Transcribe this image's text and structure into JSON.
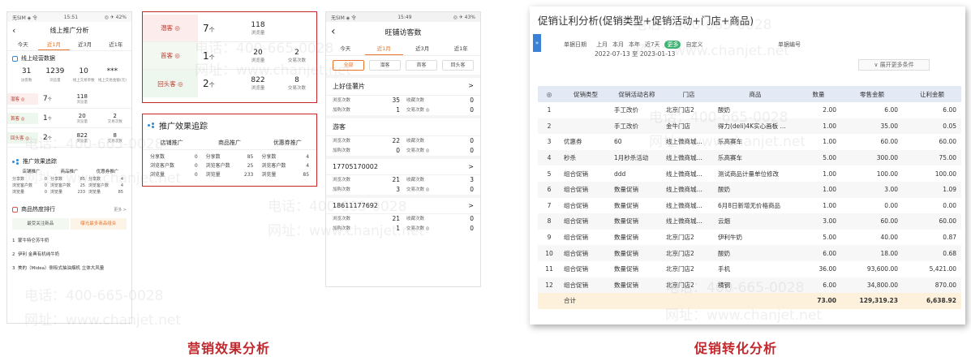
{
  "phone1": {
    "status_left": "无SIM ◈ 令",
    "status_time": "15:51",
    "status_right": "◎ ✈ 42%",
    "title": "线上推广分析",
    "tabs": [
      "今天",
      "近1月",
      "近3月",
      "近1年"
    ],
    "active_tab": 1,
    "section1": "线上经营数据",
    "stats": [
      {
        "value": "31",
        "label": "访客数"
      },
      {
        "value": "1239",
        "label": "浏览量"
      },
      {
        "value": "10",
        "label": "线上交易单数"
      },
      {
        "value": "***",
        "label": "线上交易金额(元)"
      }
    ],
    "customers": [
      {
        "label": "潜客 ◎",
        "count": "7",
        "unit": "个",
        "v1": "118",
        "l1": "浏览量",
        "v2": "",
        "l2": ""
      },
      {
        "label": "首客 ◎",
        "count": "1",
        "unit": "个",
        "v1": "20",
        "l1": "浏览量",
        "v2": "2",
        "l2": "交易次数"
      },
      {
        "label": "回头客 ◎",
        "count": "2",
        "unit": "个",
        "v1": "822",
        "l1": "浏览量",
        "v2": "8",
        "l2": "交易次数"
      }
    ],
    "section2": "推广效果追踪",
    "track_heads": [
      "店铺推广",
      "商品推广",
      "优惠券推广"
    ],
    "track_cols": [
      [
        [
          "分享数",
          "0"
        ],
        [
          "浏览客户数",
          "0"
        ],
        [
          "浏览量",
          "0"
        ]
      ],
      [
        [
          "分享数",
          "85"
        ],
        [
          "浏览客户数",
          "25"
        ],
        [
          "浏览量",
          "233"
        ]
      ],
      [
        [
          "分享数",
          "4"
        ],
        [
          "浏览客户数",
          "4"
        ],
        [
          "浏览量",
          "85"
        ]
      ]
    ],
    "section3": "商品热度排行",
    "section3_more": "更多 >",
    "rank_tabs": [
      "最受关注新品",
      "曝光最多商品组合"
    ],
    "rank_items": [
      "蒙牛特仑苏牛奶",
      "伊利 金典有机纯牛奶",
      "美的（Midea）侧吸式抽油烟机 立体大风量"
    ]
  },
  "box1": {
    "customers": [
      {
        "label": "潜客 ◎",
        "count": "7",
        "unit": "个",
        "v1": "118",
        "l1": "浏览量",
        "v2": "",
        "l2": ""
      },
      {
        "label": "首客 ◎",
        "count": "1",
        "unit": "个",
        "v1": "20",
        "l1": "浏览量",
        "v2": "2",
        "l2": "交易次数"
      },
      {
        "label": "回头客 ◎",
        "count": "2",
        "unit": "个",
        "v1": "822",
        "l1": "浏览量",
        "v2": "8",
        "l2": "交易次数"
      }
    ]
  },
  "box2": {
    "title": "推广效果追踪",
    "heads": [
      "店铺推广",
      "商品推广",
      "优惠券推广"
    ],
    "cols": [
      [
        [
          "分享数",
          "0"
        ],
        [
          "浏览客户数",
          "0"
        ],
        [
          "浏览量",
          "0"
        ]
      ],
      [
        [
          "分享数",
          "85"
        ],
        [
          "浏览客户数",
          "25"
        ],
        [
          "浏览量",
          "233"
        ]
      ],
      [
        [
          "分享数",
          "4"
        ],
        [
          "浏览客户数",
          "4"
        ],
        [
          "浏览量",
          "85"
        ]
      ]
    ]
  },
  "phone3": {
    "status_left": "无SIM ◈ 令",
    "status_time": "15:49",
    "status_right": "◎ ✈ 43%",
    "title": "旺铺访客数",
    "tabs": [
      "今天",
      "近1月",
      "近3月",
      "近1年"
    ],
    "filters": [
      "全部",
      "潜客",
      "首客",
      "回头客"
    ],
    "groups": [
      {
        "name": "上好佳薯片",
        "arrow": ">",
        "r1": [
          "浏览次数",
          "35",
          "收藏次数",
          "0"
        ],
        "r2": [
          "加购次数",
          "1",
          "交易次数 ◎",
          "0"
        ]
      },
      {
        "name": "游客",
        "arrow": "",
        "r1": [
          "浏览次数",
          "22",
          "收藏次数",
          "0"
        ],
        "r2": [
          "加购次数",
          "0",
          "交易次数 ◎",
          "0"
        ]
      },
      {
        "name": "17705170002",
        "arrow": ">",
        "r1": [
          "浏览次数",
          "21",
          "收藏次数",
          "3"
        ],
        "r2": [
          "加购次数",
          "3",
          "交易次数 ◎",
          "0"
        ]
      },
      {
        "name": "18611177692",
        "arrow": ">",
        "r1": [
          "浏览次数",
          "21",
          "收藏次数",
          "0"
        ],
        "r2": [
          "加购次数",
          "1",
          "交易次数 ◎",
          "0"
        ]
      }
    ]
  },
  "desk": {
    "title": "促销让利分析(促销类型+促销活动+门店+商品)",
    "expand_icon": "»",
    "filter_label": "单据日期",
    "periods": [
      "上月",
      "本月",
      "本年",
      "近7天",
      "更多",
      "自定义"
    ],
    "doc_no_label": "单据编号",
    "date_range": "2022-07-13 至 2023-01-13",
    "more_conditions": "∨ 展开更多条件",
    "columns": [
      "◎",
      "促销类型",
      "促销活动名称",
      "门店",
      "商品",
      "数量",
      "零售金额",
      "让利金额"
    ],
    "rows": [
      [
        "1",
        "",
        "手工改价",
        "北京门店2",
        "酸奶",
        "2.00",
        "6.00",
        "6.00"
      ],
      [
        "2",
        "",
        "手工改价",
        "金牛门店",
        "得力(deli)4K实心画板 ...",
        "1.00",
        "35.00",
        "0.05"
      ],
      [
        "3",
        "优惠券",
        "60",
        "线上微商城...",
        "乐高赛车",
        "1.00",
        "60.00",
        "60.00"
      ],
      [
        "4",
        "秒杀",
        "1月秒杀活动",
        "线上微商城...",
        "乐高赛车",
        "5.00",
        "300.00",
        "75.00"
      ],
      [
        "5",
        "组合促销",
        "ddd",
        "线上微商城...",
        "测试商品计量单位修改",
        "1.00",
        "100.00",
        "100.00"
      ],
      [
        "6",
        "组合促销",
        "数量促销",
        "线上微商城...",
        "酸奶",
        "1.00",
        "3.00",
        "1.09"
      ],
      [
        "7",
        "组合促销",
        "数量促销",
        "线上微商城...",
        "6月8日新增无价格商品",
        "1.00",
        "0.00",
        "0.00"
      ],
      [
        "8",
        "组合促销",
        "数量促销",
        "线上微商城...",
        "云烟",
        "3.00",
        "60.00",
        "60.00"
      ],
      [
        "9",
        "组合促销",
        "数量促销",
        "北京门店2",
        "伊利牛奶",
        "5.00",
        "40.00",
        "0.87"
      ],
      [
        "10",
        "组合促销",
        "数量促销",
        "北京门店2",
        "酸奶",
        "6.00",
        "18.00",
        "0.68"
      ],
      [
        "11",
        "组合促销",
        "数量促销",
        "北京门店2",
        "手机",
        "36.00",
        "93,600.00",
        "5,421.00"
      ],
      [
        "12",
        "组合促销",
        "数量促销",
        "北京门店2",
        "横钢",
        "6.00",
        "34,800.00",
        "870.00"
      ]
    ],
    "total": [
      "",
      "合计",
      "",
      "",
      "",
      "73.00",
      "129,319.23",
      "6,638.92"
    ]
  },
  "captions": {
    "left": "营销效果分析",
    "right": "促销转化分析"
  },
  "watermark": {
    "phone": "电话：400-665-0028",
    "site": "网址：www.chanjet.net"
  },
  "colors": {
    "accent": "#e8742b",
    "caption": "#c0282d",
    "box": "#c9252b",
    "header_bg": "#e3e9f5",
    "total_bg": "#fdf1dc"
  }
}
